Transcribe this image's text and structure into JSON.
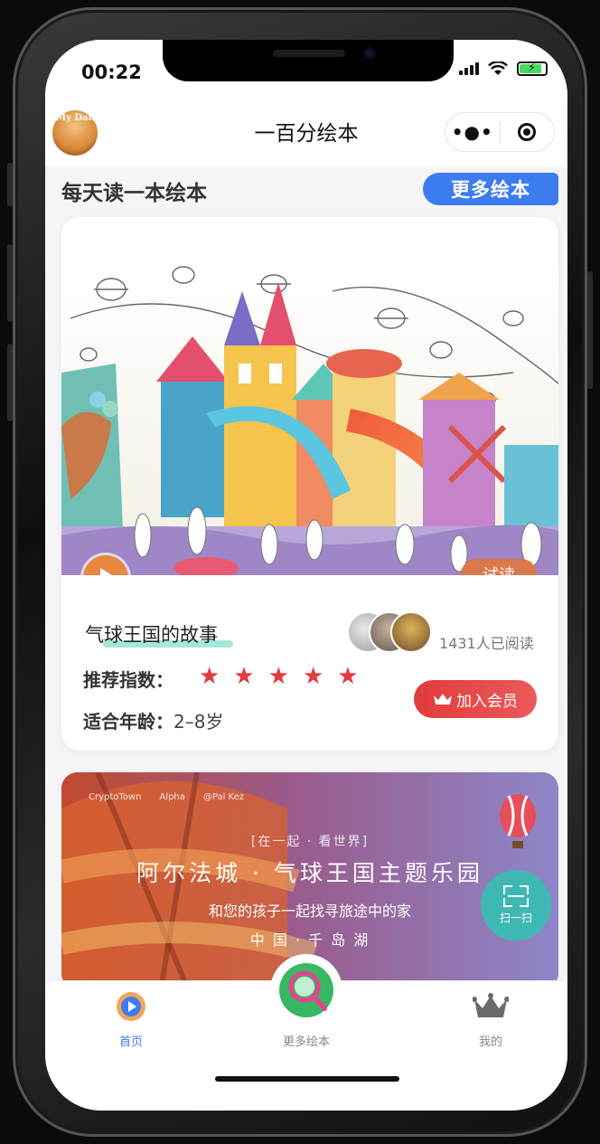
{
  "status_bar": {
    "time": "00:22"
  },
  "navbar": {
    "avatar_text": "My Dan",
    "title": "一百分绘本",
    "more_glyph": "•●•"
  },
  "section": {
    "title": "每天读一本绘本",
    "more_button": "更多绘本"
  },
  "book": {
    "title": "气球王国的故事",
    "try_label": "试读",
    "readers": "1431人已阅读",
    "rating_label": "推荐指数：",
    "rating": 5,
    "rating_max": 5,
    "stars": [
      "★",
      "★",
      "★",
      "★",
      "★"
    ],
    "age_label": "适合年龄：",
    "age_value": "2–8岁",
    "join_label": "加入会员"
  },
  "banner": {
    "brand_logos": [
      "CryptoTown",
      "Alpha",
      "@Pal Kez"
    ],
    "tagline": "[在一起 · 看世界]",
    "headline": "阿尔法城 · 气球王国主题乐园",
    "subline": "和您的孩子一起找寻旅途中的家",
    "location": "中 国 · 千 岛 湖",
    "scan_label": "扫一扫"
  },
  "tabbar": {
    "home": "首页",
    "more": "更多绘本",
    "mine": "我的"
  },
  "colors": {
    "accent_blue": "#3d7bf0",
    "star_red": "#e43b3b",
    "join_red": "#e23b3b",
    "try_orange": "#d9784a",
    "play_orange": "#e8873f",
    "scan_teal": "#3fb8b4"
  }
}
